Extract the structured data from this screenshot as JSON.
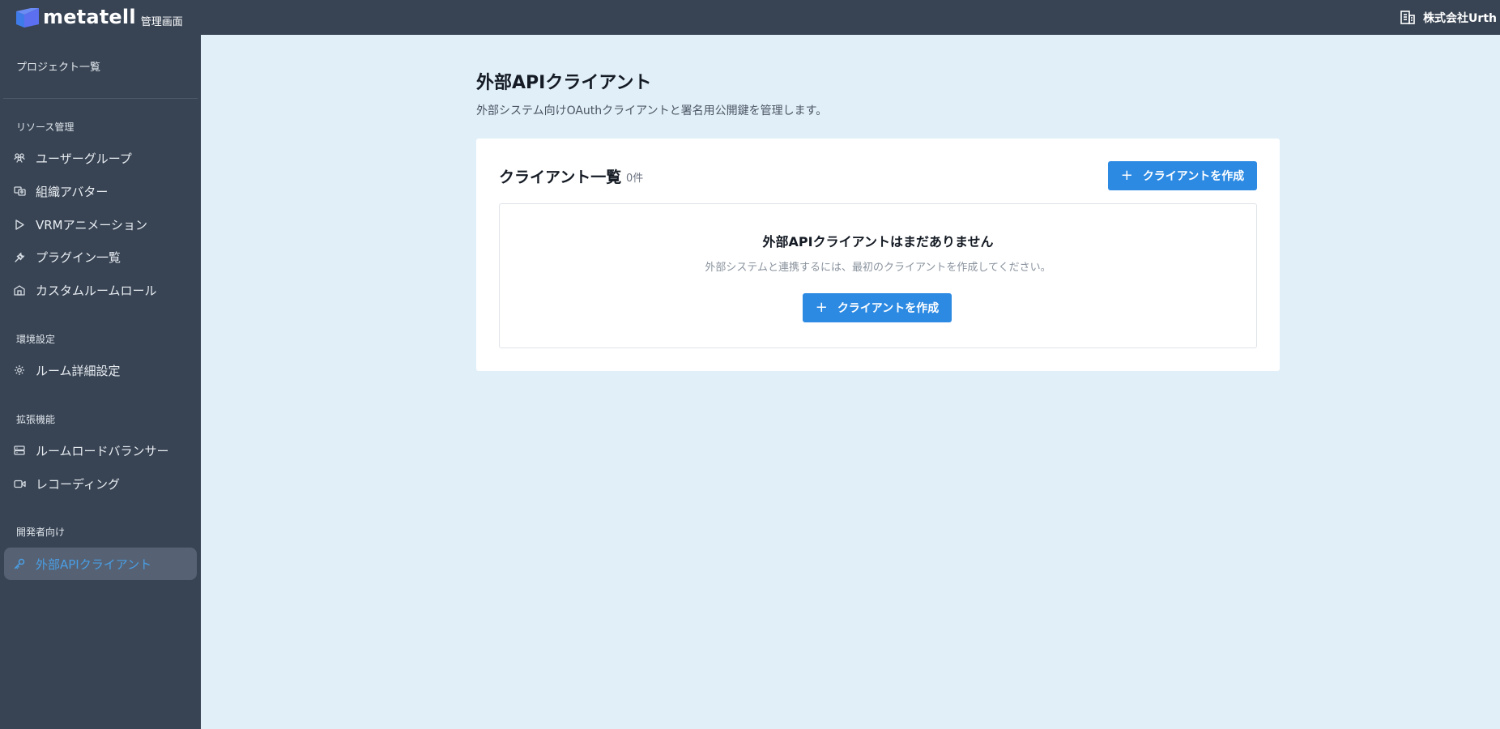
{
  "header": {
    "logo_text": "metatell",
    "logo_sub": "管理画面",
    "org_name": "株式会社Urth",
    "org_icon": "building-icon",
    "brand_colors": {
      "bar": "#384454",
      "logo_mark": "#3f7be8"
    }
  },
  "sidebar": {
    "top_link": "プロジェクト一覧",
    "sections": [
      {
        "title": "リソース管理",
        "items": [
          {
            "label": "ユーザーグループ",
            "icon": "users-icon"
          },
          {
            "label": "組織アバター",
            "icon": "avatar-group-icon"
          },
          {
            "label": "VRMアニメーション",
            "icon": "play-icon"
          },
          {
            "label": "プラグイン一覧",
            "icon": "plug-icon"
          },
          {
            "label": "カスタムルームロール",
            "icon": "building-role-icon"
          }
        ]
      },
      {
        "title": "環境設定",
        "items": [
          {
            "label": "ルーム詳細設定",
            "icon": "gear-icon"
          }
        ]
      },
      {
        "title": "拡張機能",
        "items": [
          {
            "label": "ルームロードバランサー",
            "icon": "server-icon"
          },
          {
            "label": "レコーディング",
            "icon": "video-icon"
          }
        ]
      },
      {
        "title": "開発者向け",
        "items": [
          {
            "label": "外部APIクライアント",
            "icon": "key-icon",
            "active": true
          }
        ]
      }
    ],
    "active_color": "#4a9ee6"
  },
  "main": {
    "title": "外部APIクライアント",
    "description": "外部システム向けOAuthクライアントと署名用公開鍵を管理します。",
    "card": {
      "title": "クライアント一覧",
      "count": "0件",
      "create_button": "クライアントを作成",
      "empty_title": "外部APIクライアントはまだありません",
      "empty_desc": "外部システムと連携するには、最初のクライアントを作成してください。",
      "empty_button": "クライアントを作成"
    },
    "accent_color": "#2c8ae3"
  }
}
